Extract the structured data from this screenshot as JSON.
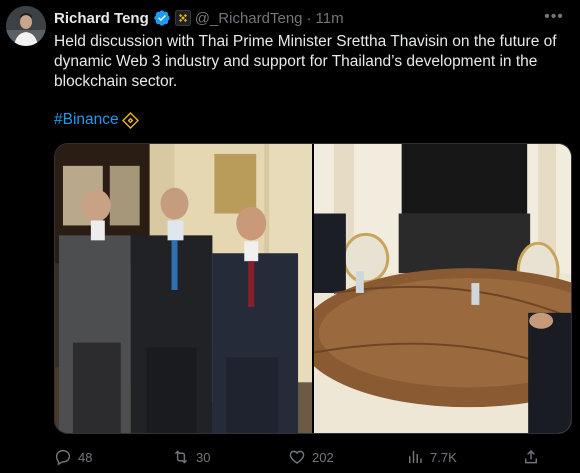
{
  "author": {
    "display_name": "Richard Teng",
    "handle": "@_RichardTeng",
    "separator": "·",
    "time": "11m",
    "verified_icon": "verified-badge-icon",
    "affiliation_icon": "binance-logo-icon"
  },
  "tweet": {
    "text": "Held discussion with Thai Prime Minister Srettha Thavisin on the future of dynamic Web 3 industry and support for Thailand’s development in the blockchain sector.",
    "hashtag": "#Binance",
    "hashtag_icon": "binance-logo-icon"
  },
  "media": {
    "photos": [
      {
        "subject": "three-men-group-photo"
      },
      {
        "subject": "meeting-room-table"
      }
    ]
  },
  "actions": {
    "replies": "48",
    "retweets": "30",
    "likes": "202",
    "views": "7.7K"
  },
  "colors": {
    "background": "#000000",
    "text": "#e7e9ea",
    "muted": "#71767b",
    "link": "#1d9bf0",
    "verified": "#1d9bf0",
    "binance": "#f0b90b"
  }
}
